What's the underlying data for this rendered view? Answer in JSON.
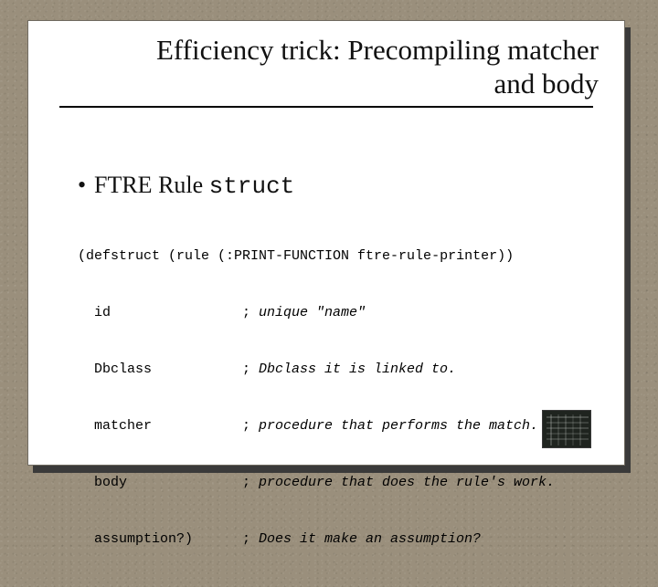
{
  "title_line1": "Efficiency trick: Precompiling matcher",
  "title_line2": "and body",
  "bullet": {
    "text": "FTRE Rule ",
    "code": "struct"
  },
  "code": {
    "line1": "(defstruct (rule (:PRINT-FUNCTION ftre-rule-printer))",
    "fields": [
      {
        "name": "  id",
        "comment": "unique \"name\""
      },
      {
        "name": "  Dbclass",
        "comment": "Dbclass it is linked to."
      },
      {
        "name": "  matcher",
        "comment": "procedure that performs the match."
      },
      {
        "name": "  body",
        "comment": "procedure that does the rule's work."
      },
      {
        "name": "  assumption?)",
        "comment": "Does it make an assumption?"
      }
    ],
    "semicolon": ";"
  }
}
